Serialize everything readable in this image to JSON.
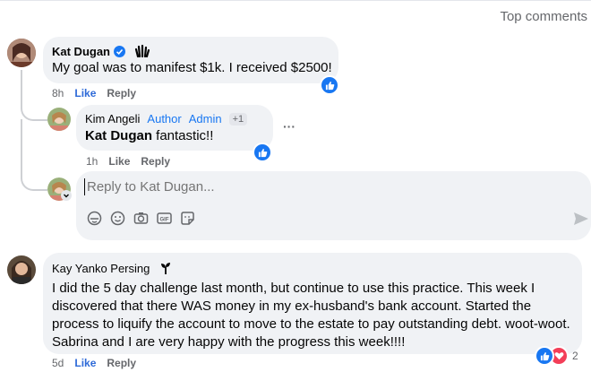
{
  "sort_label": "Top comments",
  "comment1": {
    "author": "Kat Dugan",
    "text": "My goal was to manifest $1k. I received $2500!",
    "time": "8h",
    "like": "Like",
    "reply": "Reply"
  },
  "reply1": {
    "author": "Kim Angeli",
    "role_author": "Author",
    "role_admin": "Admin",
    "plus": "+1",
    "mention": "Kat Dugan",
    "text": " fantastic!!",
    "time": "1h",
    "like": "Like",
    "reply": "Reply",
    "more": "···"
  },
  "composer": {
    "placeholder": "Reply to Kat Dugan..."
  },
  "comment2": {
    "author": "Kay Yanko Persing",
    "text": "I did the 5 day challenge last month, but continue to use this practice. This week I discovered that there WAS money in my ex-husband's bank account. Started the process to liquify the account to move to the estate to pay outstanding debt. woot-woot. Sabrina and I are very happy with the progress this week!!!!",
    "time": "5d",
    "like": "Like",
    "reply": "Reply",
    "reaction_count": "2"
  },
  "colors": {
    "accent": "#1877f2",
    "bubble": "#f0f2f5",
    "muted": "#65676b"
  }
}
